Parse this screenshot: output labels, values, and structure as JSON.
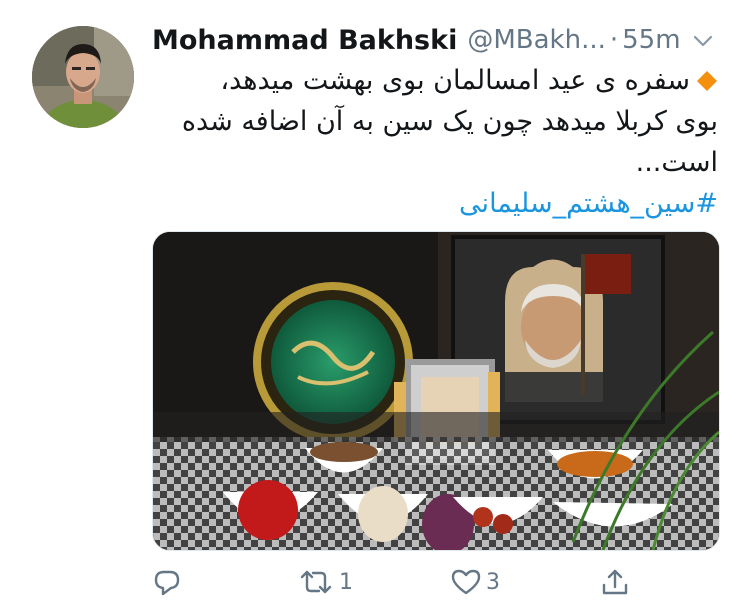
{
  "tweet": {
    "display_name": "Mohammad Bakhski",
    "handle": "@MBakh...",
    "separator": "·",
    "timestamp": "55m",
    "text_line1": "سفره ی عید امسالمان بوی بهشت میدهد،",
    "text_line2": "بوی کربلا میدهد چون یک سین به آن اضافه شده",
    "text_line3": "است...",
    "hashtag": "#سین_هشتم_سلیمانی"
  },
  "actions": {
    "reply_count": "",
    "retweet_count": "1",
    "like_count": "3"
  },
  "icons": {
    "avatar": "avatar",
    "caret": "chevron-down-icon",
    "emoji": "orange-diamond-icon",
    "reply": "reply-icon",
    "retweet": "retweet-icon",
    "like": "heart-icon",
    "share": "share-icon"
  },
  "colors": {
    "text": "#14171a",
    "secondary": "#657786",
    "link": "#1b95e0",
    "background": "#ffffff"
  }
}
